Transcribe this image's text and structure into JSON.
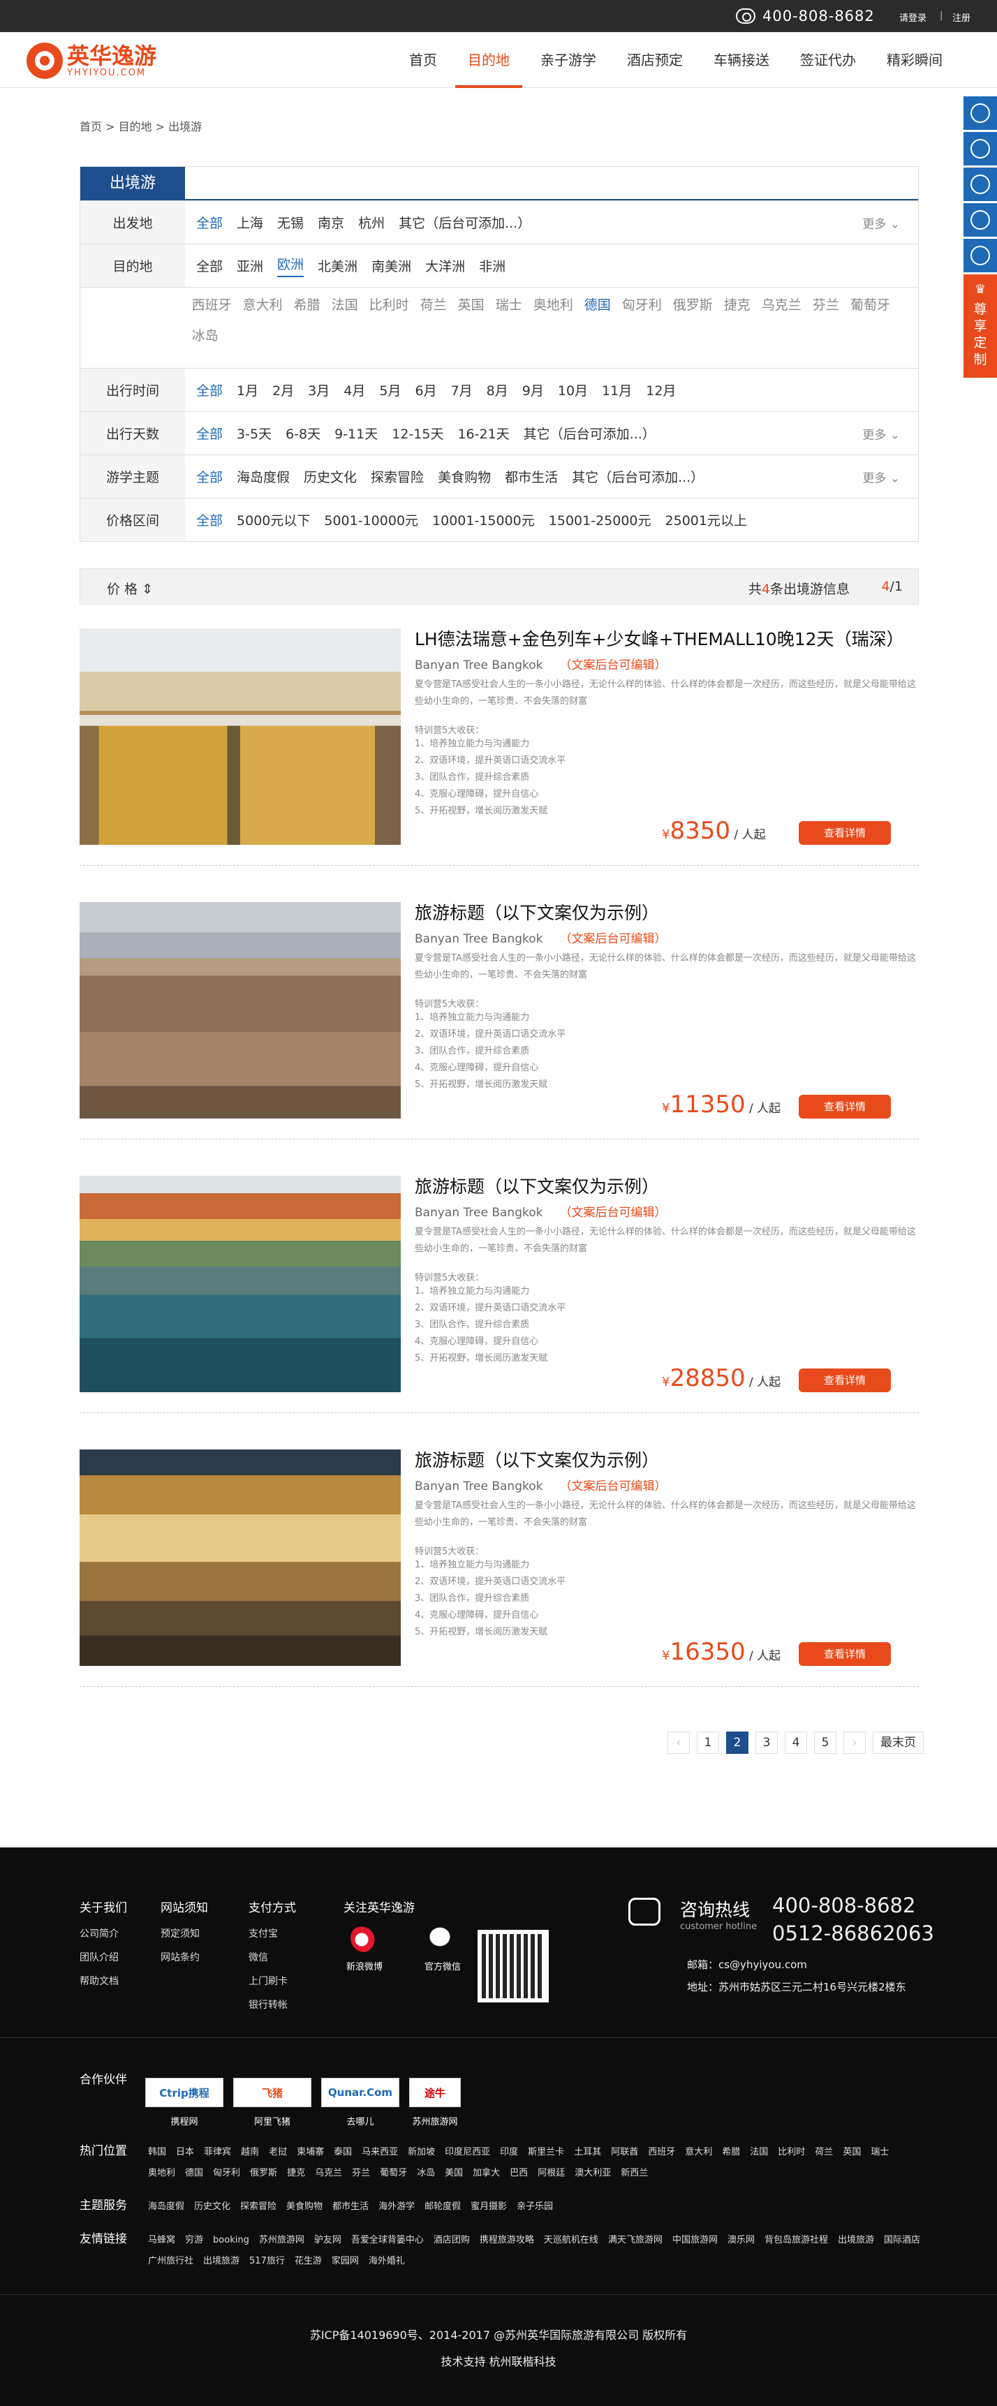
{
  "topbar": {
    "phone": "400-808-8682",
    "login": "请登录",
    "sep": "|",
    "register": "注册"
  },
  "logo": {
    "cn": "英华逸游",
    "en": "YHYIYOU.COM"
  },
  "nav": [
    "首页",
    "目的地",
    "亲子游学",
    "酒店预定",
    "车辆接送",
    "签证代办",
    "精彩瞬间"
  ],
  "side": {
    "custom": "尊享定制"
  },
  "breadcrumb": "首页 >  目的地 >  出境游",
  "filter": {
    "tab": "出境游",
    "more": "更多 ⌄",
    "rows": {
      "depart": {
        "label": "出发地",
        "opts": [
          "全部",
          "上海",
          "无锡",
          "南京",
          "杭州",
          "其它（后台可添加...）"
        ]
      },
      "dest": {
        "label": "目的地",
        "opts": [
          "全部",
          "亚洲",
          "欧洲",
          "北美洲",
          "南美洲",
          "大洋洲",
          "非洲"
        ]
      },
      "countries": [
        "西班牙",
        "意大利",
        "希腊",
        "法国",
        "比利时",
        "荷兰",
        "英国",
        "瑞士",
        "奥地利",
        "德国",
        "匈牙利",
        "俄罗斯",
        "捷克",
        "乌克兰",
        "芬兰",
        "葡萄牙",
        "冰岛"
      ],
      "time": {
        "label": "出行时间",
        "opts": [
          "全部",
          "1月",
          "2月",
          "3月",
          "4月",
          "5月",
          "6月",
          "7月",
          "8月",
          "9月",
          "10月",
          "11月",
          "12月"
        ]
      },
      "days": {
        "label": "出行天数",
        "opts": [
          "全部",
          "3-5天",
          "6-8天",
          "9-11天",
          "12-15天",
          "16-21天",
          "其它（后台可添加...）"
        ]
      },
      "theme": {
        "label": "游学主题",
        "opts": [
          "全部",
          "海岛度假",
          "历史文化",
          "探索冒险",
          "美食购物",
          "都市生活",
          "其它（后台可添加...）"
        ]
      },
      "price": {
        "label": "价格区间",
        "opts": [
          "全部",
          "5000元以下",
          "5001-10000元",
          "10001-15000元",
          "15001-25000元",
          "25001元以上"
        ]
      }
    }
  },
  "sortbar": {
    "price": "价 格 ⇕",
    "total_pre": "共",
    "total_num": "4",
    "total_post": "条出境游信息",
    "page_cur": "4",
    "page_total": "/1"
  },
  "products": [
    {
      "title": "LH德法瑞意+金色列车+少女峰+THEMALL10晚12天（瑞深）",
      "sub": "Banyan Tree Bangkok",
      "sub_note": "（文案后台可编辑）",
      "price": "8350",
      "image": "tram-photo"
    },
    {
      "title": "旅游标题（以下文案仅为示例）",
      "sub": "Banyan Tree Bangkok",
      "sub_note": "（文案后台可编辑）",
      "price": "11350",
      "image": "toledo-photo"
    },
    {
      "title": "旅游标题（以下文案仅为示例）",
      "sub": "Banyan Tree Bangkok",
      "sub_note": "（文案后台可编辑）",
      "price": "28850",
      "image": "cinqueterre-photo"
    },
    {
      "title": "旅游标题（以下文案仅为示例）",
      "sub": "Banyan Tree Bangkok",
      "sub_note": "（文案后台可编辑）",
      "price": "16350",
      "image": "station-photo"
    }
  ],
  "product_common": {
    "desc": "夏令营是TA感受社会人生的一条小小路径，无论什么样的体验、什么样的体会都是一次经历，而这些经历，就是父母能带给这些幼小生命的，一笔珍贵、不会失落的财富",
    "feat_title": "特训营5大收获：",
    "feats": [
      "1、培养独立能力与沟通能力",
      "2、双语环境，提升英语口语交流水平",
      "3、团队合作，提升综合素质",
      "4、克服心理障碍，提升自信心",
      "5、开拓视野，增长阅历激发天赋"
    ],
    "currency": "¥",
    "unit": " / 人起",
    "detail": "查看详情"
  },
  "pager": [
    "‹",
    "1",
    "2",
    "3",
    "4",
    "5",
    "›",
    "最末页"
  ],
  "footer": {
    "cols": [
      {
        "h": "关于我们",
        "items": [
          "公司简介",
          "团队介绍",
          "帮助文档"
        ]
      },
      {
        "h": "网站须知",
        "items": [
          "预定须知",
          "网站条约"
        ]
      },
      {
        "h": "支付方式",
        "items": [
          "支付宝",
          "微信",
          "上门刷卡",
          "银行转帐"
        ]
      }
    ],
    "follow": "关注英华逸游",
    "weibo": "新浪微博",
    "wechat": "官方微信",
    "hotline_cn": "咨询热线",
    "hotline_en": "customer hotline",
    "tel1": "400-808-8682",
    "tel2": "0512-86862063",
    "email": "邮箱：cs@yhyiyou.com",
    "addr": "地址：苏州市姑苏区三元二村16号兴元楼2楼东",
    "partners_h": "合作伙伴",
    "partners": [
      {
        "logo": "Ctrip携程",
        "name": "携程网"
      },
      {
        "logo": "飞猪",
        "name": "阿里飞猪"
      },
      {
        "logo": "Qunar.Com",
        "name": "去哪儿"
      },
      {
        "logo": "途牛",
        "name": "苏州旅游网"
      }
    ],
    "hot_h": "热门位置",
    "hot": [
      "韩国",
      "日本",
      "菲律宾",
      "越南",
      "老挝",
      "柬埔寨",
      "泰国",
      "马来西亚",
      "新加坡",
      "印度尼西亚",
      "印度",
      "斯里兰卡",
      "土耳其",
      "阿联酋",
      "西班牙",
      "意大利",
      "希腊",
      "法国",
      "比利时",
      "荷兰",
      "英国",
      "瑞士",
      "奥地利",
      "德国",
      "匈牙利",
      "俄罗斯",
      "捷克",
      "乌克兰",
      "芬兰",
      "葡萄牙",
      "冰岛",
      "美国",
      "加拿大",
      "巴西",
      "阿根廷",
      "澳大利亚",
      "新西兰"
    ],
    "theme_h": "主题服务",
    "theme": [
      "海岛度假",
      "历史文化",
      "探索冒险",
      "美食购物",
      "都市生活",
      "海外游学",
      "邮轮度假",
      "蜜月摄影",
      "亲子乐园"
    ],
    "links_h": "友情链接",
    "links": [
      "马蜂窝",
      "穷游",
      "booking",
      "苏州旅游网",
      "驴友网",
      "吾爱全球背篓中心",
      "酒店团购",
      "携程旅游攻略",
      "天巡航机在线",
      "满天飞旅游网",
      "中国旅游网",
      "澳乐网",
      "背包岛旅游社程",
      "出境旅游",
      "国际酒店",
      "广州旅行社",
      "出境旅游",
      "517旅行",
      "花生游",
      "家园网",
      "海外婚礼"
    ],
    "copy1": "苏ICP备14019690号、2014-2017  @苏州英华国际旅游有限公司 版权所有",
    "copy2": "技术支持  杭州联楷科技"
  }
}
